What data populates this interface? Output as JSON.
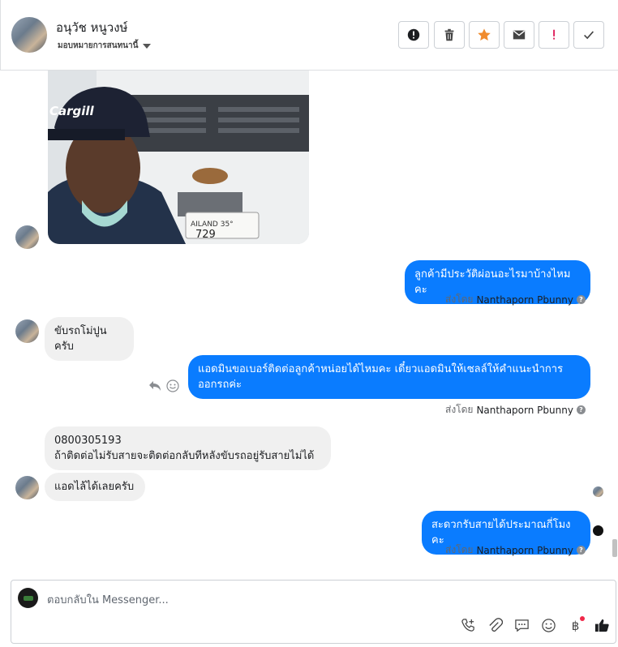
{
  "header": {
    "customer_name": "อนุวัช หนูวงษ์",
    "assign_label": "มอบหมายการสนทนานี้"
  },
  "messages": {
    "out_1": "ลูกค้ามีประวัติผ่อนอะไรมาบ้างไหมคะ",
    "in_1": "ขับรถโม่ปูนครับ",
    "out_2": "แอดมินขอเบอร์ติดต่อลูกค้าหน่อยได้ไหมคะ เดี๋ยวแอดมินให้เซลล์ให้คำแนะนำการออกรถค่ะ",
    "in_2": "0800305193\nถ้าติดต่อไม่รับสายจะติดต่อกลับทีหลังขับรถอยู่รับสายไม่ได้",
    "in_3": "แอดไล้ได้เลยครับ",
    "out_3": "สะดวกรับสายได้ประมาณกี่โมงคะ"
  },
  "sent_by": {
    "prefix": "ส่งโดย",
    "name": "Nanthaporn Pbunny"
  },
  "image_logo_text": "Cargill",
  "composer": {
    "placeholder": "ตอบกลับใน Messenger..."
  },
  "colors": {
    "outgoing_bubble": "#0a7cff",
    "incoming_bubble": "#f0f0f0",
    "star": "#f08b2d",
    "alert": "#e0245e"
  },
  "icons": {
    "header_actions": [
      "spam-icon",
      "trash-icon",
      "star-icon",
      "email-icon",
      "exclamation-icon",
      "check-icon"
    ],
    "composer_tools": [
      "call-icon",
      "attach-icon",
      "saved-reply-icon",
      "emoji-icon",
      "payment-icon",
      "like-icon"
    ]
  }
}
